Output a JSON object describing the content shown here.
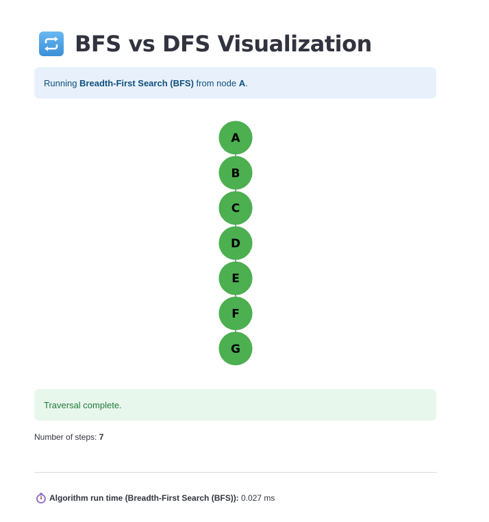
{
  "header": {
    "icon": "repeat-arrows-icon",
    "title": "BFS vs DFS Visualization"
  },
  "info_alert": {
    "prefix": "Running ",
    "algorithm": "Breadth-First Search (BFS)",
    "middle": " from node ",
    "start_node": "A",
    "suffix": "."
  },
  "graph": {
    "nodes": [
      "A",
      "B",
      "C",
      "D",
      "E",
      "F",
      "G"
    ],
    "edges": [
      [
        "A",
        "B"
      ],
      [
        "B",
        "C"
      ],
      [
        "C",
        "D"
      ],
      [
        "D",
        "E"
      ],
      [
        "E",
        "F"
      ],
      [
        "F",
        "G"
      ]
    ],
    "node_color": "#4caf50",
    "edge_color": "#333333",
    "label_color": "#000000"
  },
  "success_alert": {
    "text": "Traversal complete."
  },
  "steps": {
    "label": "Number of steps: ",
    "value": "7"
  },
  "runtime": {
    "icon": "stopwatch-icon",
    "label": "Algorithm run time (Breadth-First Search (BFS)):",
    "value": " 0.027 ms"
  },
  "colors": {
    "info_bg": "#e8f1fb",
    "info_text": "#0f4f7e",
    "success_bg": "#e8f7ec",
    "success_text": "#1f7a3a"
  }
}
